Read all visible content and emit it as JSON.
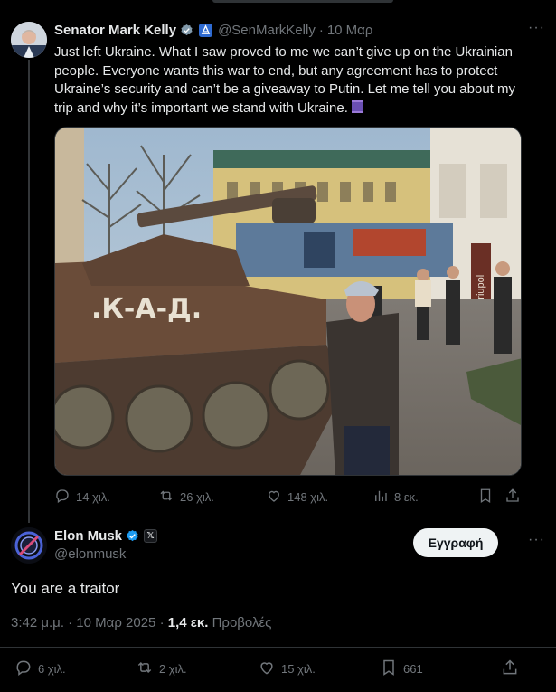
{
  "tweet1": {
    "name": "Senator Mark Kelly",
    "handle": "@SenMarkKelly",
    "separator": "·",
    "date": "10 Μαρ",
    "more": "···",
    "text": "Just left Ukraine. What I saw proved to me we can’t give up on the Ukrainian people. Everyone wants this war to end, but any agreement has to protect Ukraine’s security and can’t be a giveaway to Putin. Let me tell you about my trip and why it’s important we stand with Ukraine.",
    "photo_sign": "Mariupol",
    "tank_graffiti": ".К-А-Д.",
    "replies": "14 χιλ.",
    "reposts": "26 χιλ.",
    "likes": "148 χιλ.",
    "views": "8 εκ.",
    "icons": [
      "verified-badge-icon",
      "government-badge-icon",
      "reply-icon",
      "repost-icon",
      "like-icon",
      "views-icon",
      "bookmark-icon",
      "share-icon"
    ]
  },
  "tweet2": {
    "name": "Elon Musk",
    "x_badge": "𝕏",
    "handle": "@elonmusk",
    "subscribe_label": "Εγγραφή",
    "more": "···",
    "text": "You are a traitor",
    "timestamp": "3:42 μ.μ. · 10 Μαρ 2025",
    "views_sep": "·",
    "views_count": "1,4 εκ.",
    "views_label": "Προβολές",
    "replies": "6 χιλ.",
    "reposts": "2 χιλ.",
    "likes": "15 χιλ.",
    "bookmarks": "661"
  },
  "colors": {
    "background": "#000000",
    "text": "#e7e9ea",
    "muted": "#71767b",
    "verified": "#1d9bf0",
    "divider": "#2f3336"
  }
}
